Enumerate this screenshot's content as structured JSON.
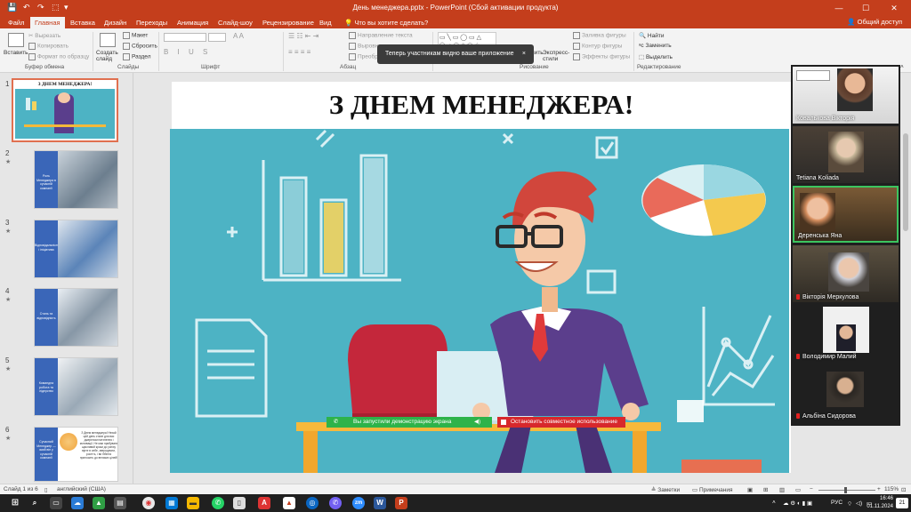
{
  "window": {
    "title": "День менеджера.pptx - PowerPoint (Сбой активации продукта)",
    "quick_access": [
      "💾",
      "↶",
      "↷",
      "⬚",
      "▾"
    ]
  },
  "tabs": [
    "Файл",
    "Главная",
    "Вставка",
    "Дизайн",
    "Переходы",
    "Анимация",
    "Слайд-шоу",
    "Рецензирование",
    "Вид"
  ],
  "active_tab": "Главная",
  "tell_me": "Что вы хотите сделать?",
  "share_button": "Общий доступ",
  "ribbon": {
    "clipboard": {
      "paste": "Вставить",
      "cut": "Вырезать",
      "copy": "Копировать",
      "format_painter": "Формат по образцу",
      "label": "Буфер обмена"
    },
    "slides": {
      "new_slide": "Создать слайд",
      "layout": "Макет",
      "reset": "Сбросить",
      "section": "Раздел",
      "label": "Слайды"
    },
    "font": {
      "label": "Шрифт"
    },
    "paragraph": {
      "text_direction": "Направление текста",
      "align_text": "Выровнять текст",
      "smartart": "Преобр",
      "label": "Абзац"
    },
    "drawing": {
      "arrange": "Упорядочить",
      "quick_styles": "Экспресс-стили",
      "shape_fill": "Заливка фигуры",
      "shape_outline": "Контур фигуры",
      "shape_effects": "Эффекты фигуры",
      "label": "Рисование"
    },
    "editing": {
      "find": "Найти",
      "replace": "Заменить",
      "select": "Выделить",
      "label": "Редактирование"
    }
  },
  "toast": {
    "text": "Теперь участникам видно ваше приложение",
    "close": "×"
  },
  "thumbnails": [
    {
      "num": "1",
      "title": "З ДНЕМ МЕНЕДЖЕРА!"
    },
    {
      "num": "2",
      "star": "★",
      "bar_text": "Роль Менеджера в сучасній компанії"
    },
    {
      "num": "3",
      "star": "★",
      "bar_text": "Відповідальність і ініціатива"
    },
    {
      "num": "4",
      "star": "★",
      "bar_text": "Стиль та відповідність"
    },
    {
      "num": "5",
      "star": "★",
      "bar_text": "Командна робота та лідерство"
    },
    {
      "num": "6",
      "star": "★",
      "bar_text": "Сучасний Менеджер — який він у сучасній компанії",
      "body_text": "З Днем менеджера! Нехай цей день стане для вас джерелом натхнення і мотивації. Не має прибувати щасливий кроки до успіху вірте в себе, звершувати, ростіть, і ви бібліта приносить до великих цілей!"
    }
  ],
  "slide": {
    "title": "З ДНЕМ МЕНЕДЖЕРА!"
  },
  "participants": [
    {
      "name": "Ковалькова Вікторія",
      "muted": false,
      "active": false
    },
    {
      "name": "Tetiana Koliada",
      "muted": false,
      "active": false
    },
    {
      "name": "Деренська Яна",
      "muted": false,
      "active": true
    },
    {
      "name": "Вікторія Меркулова",
      "muted": true,
      "active": false
    },
    {
      "name": "Володимир Малий",
      "muted": true,
      "active": false
    },
    {
      "name": "Альбіна Сидорова",
      "muted": true,
      "active": false
    }
  ],
  "screen_share": {
    "status": "Вы запустили демонстрацию экрана",
    "stop": "Остановить совместное использование"
  },
  "statusbar": {
    "slide_counter": "Слайд 1 из 6",
    "language": "английский (США)",
    "notes": "Заметки",
    "comments": "Примечания",
    "zoom": "115%"
  },
  "taskbar": {
    "language": "РУС",
    "time": "16:46",
    "date": "01.11.2024",
    "notifications": "21"
  },
  "colors": {
    "accent": "#c43e1c",
    "illustration_bg": "#4db3c4",
    "share_green": "#2eb34a",
    "stop_red": "#d7282c"
  }
}
